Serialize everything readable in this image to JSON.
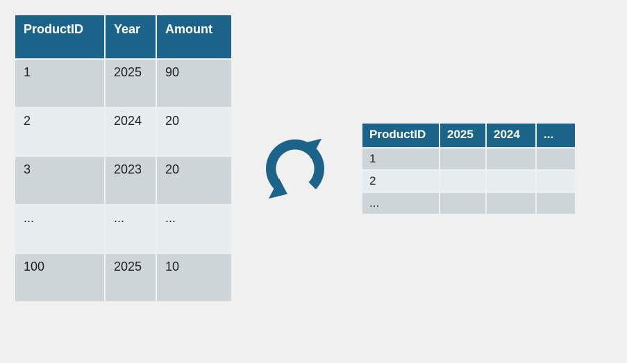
{
  "colors": {
    "header_bg": "#1b6388",
    "header_text": "#ffffff",
    "row_odd": "#ced5d9",
    "row_even": "#e7ecee",
    "icon": "#1b6388"
  },
  "left_table": {
    "headers": [
      "ProductID",
      "Year",
      "Amount"
    ],
    "rows": [
      {
        "pid": "1",
        "year": "2025",
        "amount": "90"
      },
      {
        "pid": "2",
        "year": "2024",
        "amount": "20"
      },
      {
        "pid": "3",
        "year": "2023",
        "amount": "20"
      },
      {
        "pid": "...",
        "year": "...",
        "amount": "..."
      },
      {
        "pid": "100",
        "year": "2025",
        "amount": "10"
      }
    ]
  },
  "right_table": {
    "headers": [
      "ProductID",
      "2025",
      "2024",
      "..."
    ],
    "rows": [
      {
        "pid": "1",
        "c1": "",
        "c2": "",
        "c3": ""
      },
      {
        "pid": "2",
        "c1": "",
        "c2": "",
        "c3": ""
      },
      {
        "pid": "...",
        "c1": "",
        "c2": "",
        "c3": ""
      }
    ]
  },
  "icon_name": "refresh-cycle-icon"
}
